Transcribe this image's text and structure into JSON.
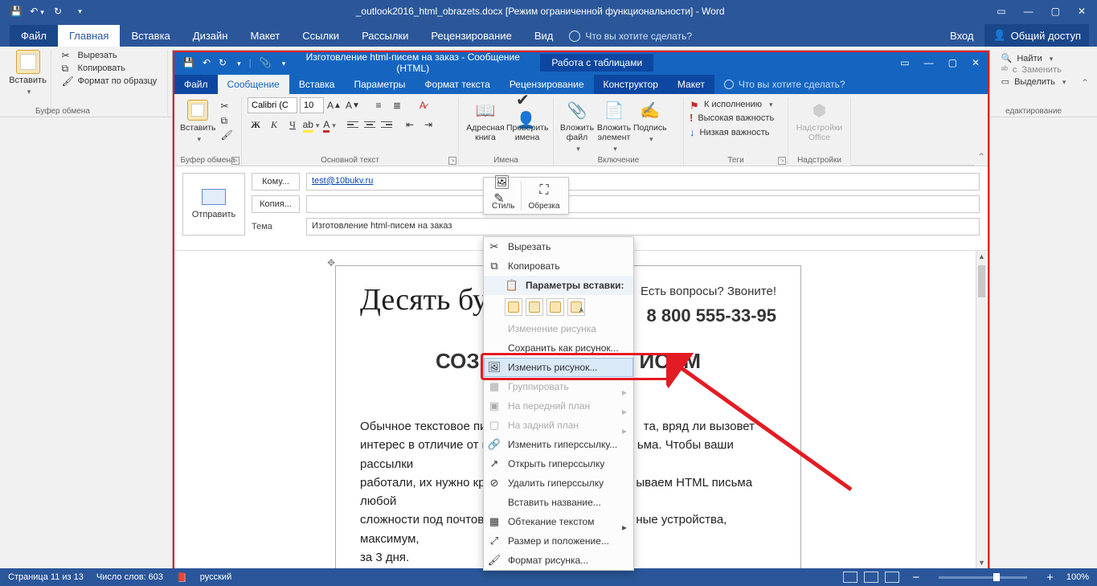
{
  "word": {
    "title": "_outlook2016_html_obrazets.docx [Режим ограниченной функциональности] - Word",
    "tabs": {
      "file": "Файл",
      "home": "Главная",
      "insert": "Вставка",
      "design": "Дизайн",
      "layout": "Макет",
      "references": "Ссылки",
      "mailings": "Рассылки",
      "review": "Рецензирование",
      "view": "Вид",
      "tellme": "Что вы хотите сделать?",
      "signin": "Вход",
      "share": "Общий доступ"
    },
    "ribbon": {
      "paste": "Вставить",
      "cut": "Вырезать",
      "copy": "Копировать",
      "formatpainter": "Формат по образцу",
      "clipboard_group": "Буфер обмена",
      "find": "Найти",
      "replace": "Заменить",
      "select": "Выделить",
      "editing_group": "едактирование"
    },
    "status": {
      "page": "Страница 11 из 13",
      "words": "Число слов: 603",
      "lang": "русский",
      "zoom": "100%"
    }
  },
  "outlook": {
    "title": "Изготовление html-писем на заказ - Сообщение (HTML)",
    "context_tab": "Работа с таблицами",
    "tabs": {
      "file": "Файл",
      "message": "Сообщение",
      "insert": "Вставка",
      "options": "Параметры",
      "format": "Формат текста",
      "review": "Рецензирование",
      "design": "Конструктор",
      "layout": "Макет",
      "tellme": "Что вы хотите сделать?"
    },
    "ribbon": {
      "paste": "Вставить",
      "clipboard_group": "Буфер обмена",
      "font_name": "Calibri (С",
      "font_size": "10",
      "basictext_group": "Основной текст",
      "addressbook": "Адресная книга",
      "checknames": "Проверить имена",
      "names_group": "Имена",
      "attachfile": "Вложить файл",
      "attachitem": "Вложить элемент",
      "signature": "Подпись",
      "include_group": "Включение",
      "followup": "К исполнению",
      "highimp": "Высокая важность",
      "lowimp": "Низкая важность",
      "tags_group": "Теги",
      "addins": "Надстройки Office",
      "addins_group": "Надстройки"
    },
    "compose": {
      "send": "Отправить",
      "to_btn": "Кому...",
      "cc_btn": "Копия...",
      "subject_lbl": "Тема",
      "to_val": "test@10bukv.ru",
      "subject_val": "Изготовление html-писем на заказ"
    },
    "minitoolbar": {
      "style": "Стиль",
      "crop": "Обрезка"
    },
    "contextmenu": {
      "cut": "Вырезать",
      "copy": "Копировать",
      "paste_header": "Параметры вставки:",
      "changepic_dim": "Изменение рисунка",
      "saveas": "Сохранить как рисунок...",
      "changepic": "Изменить рисунок...",
      "group": "Группировать",
      "bringfront": "На передний план",
      "sendback": "На задний план",
      "edithyper": "Изменить гиперссылку...",
      "openhyper": "Открыть гиперссылку",
      "removehyper": "Удалить гиперссылку",
      "caption": "Вставить название...",
      "wrap": "Обтекание текстом",
      "sizepos": "Размер и положение...",
      "formatpic": "Формат рисунка..."
    },
    "email": {
      "logo": "Десять букв",
      "call_q": "Есть вопросы? Звоните!",
      "phone": "8 800 555-33-95",
      "headline_left": "СОЗ",
      "headline_right": "ИСЕМ",
      "body1a": "Обычное текстовое пись",
      "body1b": "та, вряд ли вызовет",
      "body2a": "интерес в отличие от кра",
      "body2b": "ьма. Чтобы ваши рассылки",
      "body3a": "работали, их нужно крас",
      "body3b": "ываем HTML письма любой",
      "body4a": "сложности под почтовые",
      "body4b": "ные устройства, максимум,",
      "body5": "за 3 дня."
    }
  }
}
